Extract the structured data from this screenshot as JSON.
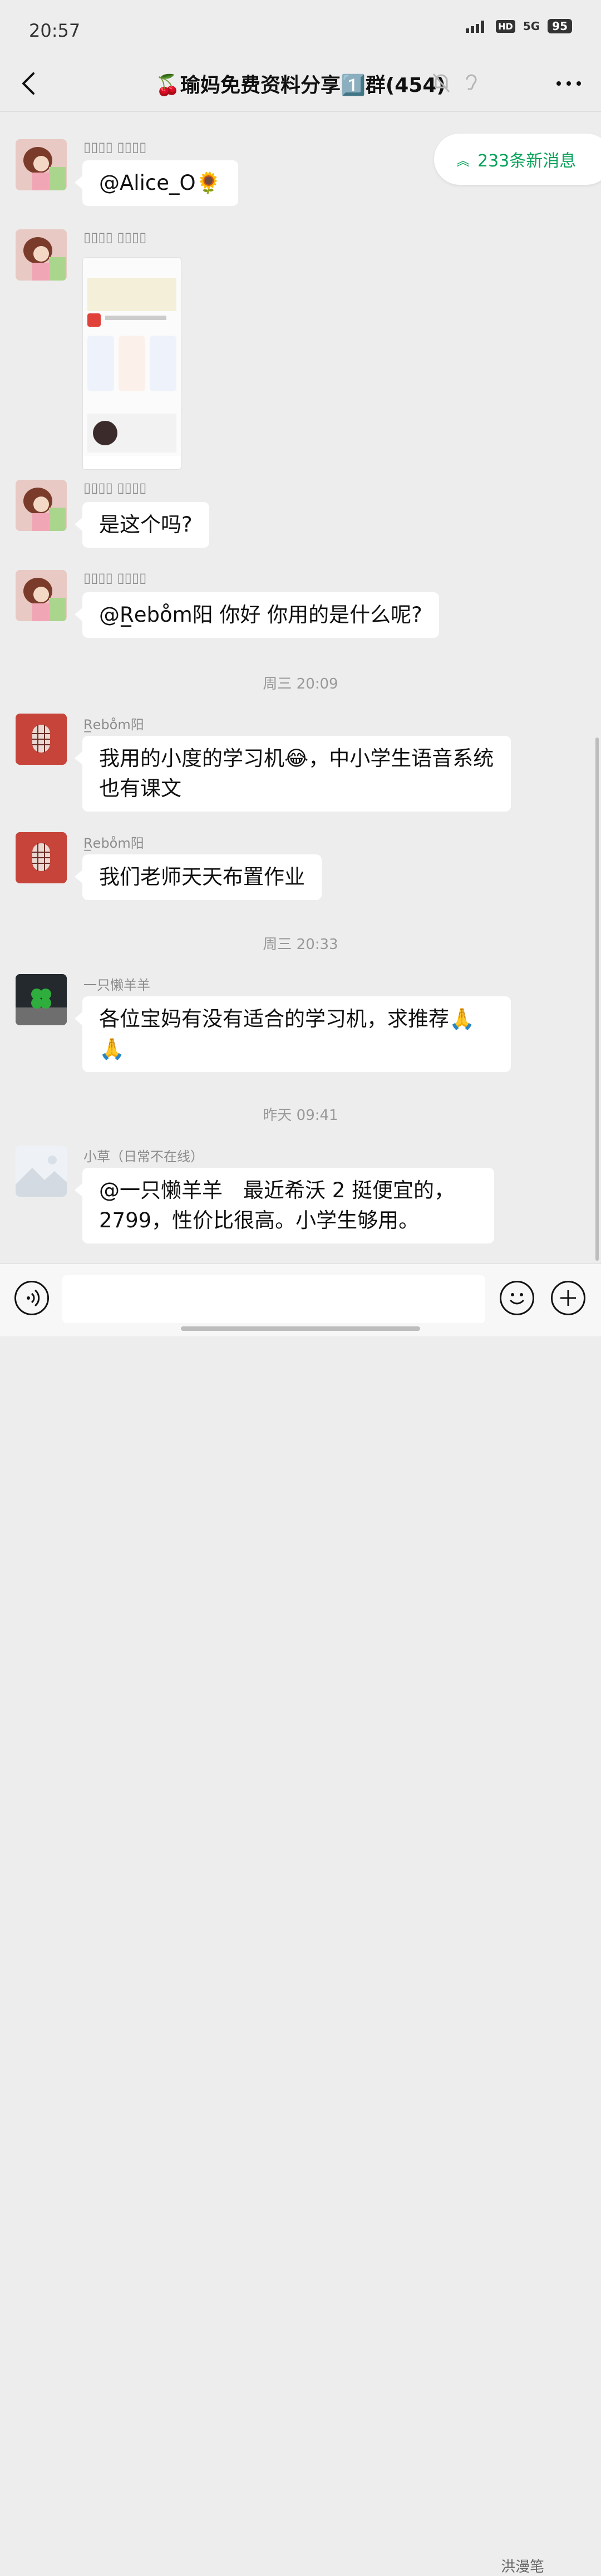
{
  "status_bar": {
    "time": "20:57",
    "hd": "HD",
    "network": "5G",
    "battery": "95"
  },
  "header": {
    "title": "🍒瑜妈免费资料分享1️⃣群(454)",
    "back_icon": "chevron-left-icon",
    "more_icon": "more-icon"
  },
  "new_messages": {
    "label": "233条新消息"
  },
  "messages": [
    {
      "sender": "▯▯▯▯ ▯▯▯▯",
      "text": "@Alice_O🌻"
    },
    {
      "sender": "▯▯▯▯ ▯▯▯▯",
      "attachment": "screenshot"
    },
    {
      "sender": "▯▯▯▯ ▯▯▯▯",
      "text": "是这个吗?"
    },
    {
      "sender": "▯▯▯▯ ▯▯▯▯",
      "text": "@R̲ebo̊m阳 你好 你用的是什么呢?"
    },
    {
      "sender": "R̲ebo̊m阳",
      "text": "我用的小度的学习机😂，中小学生语音系统也有课文"
    },
    {
      "sender": "R̲ebo̊m阳",
      "text": "我们老师天天布置作业"
    },
    {
      "sender": "一只懒羊羊",
      "text": "各位宝妈有没有适合的学习机，求推荐🙏🙏"
    },
    {
      "sender": "小草（日常不在线）",
      "text": "@一只懒羊羊　最近希沃 2 挺便宜的，2799，性价比很高。小学生够用。"
    }
  ],
  "timestamps": {
    "t1": "周三 20:09",
    "t2": "周三 20:33",
    "t3": "昨天 09:41"
  },
  "input_bar": {
    "placeholder": "",
    "watermark": "洪漫笔"
  }
}
